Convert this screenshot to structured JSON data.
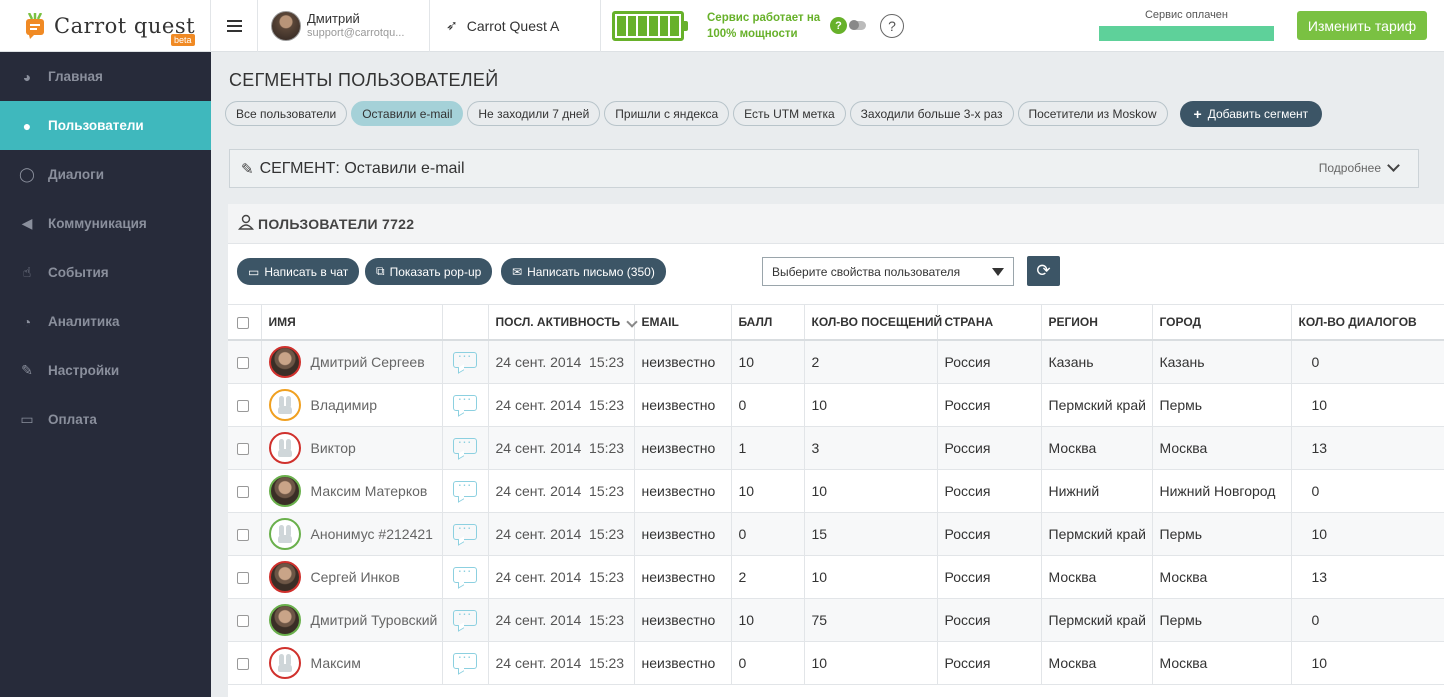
{
  "app": {
    "logo_text": "Carrot quest",
    "logo_badge": "beta"
  },
  "user": {
    "name": "Дмитрий",
    "email": "support@carrotqu..."
  },
  "project": {
    "name": "Carrot Quest A"
  },
  "service": {
    "status": "Сервис работает на 100% мощности",
    "help": "?",
    "paid_label": "Сервис оплачен",
    "paid_fraction": 1.0,
    "change_tariff": "Изменить тариф"
  },
  "sidebar": {
    "items": [
      {
        "label": "Главная",
        "icon": "dashboard-icon",
        "glyph": "◕"
      },
      {
        "label": "Пользователи",
        "icon": "user-icon",
        "glyph": "●"
      },
      {
        "label": "Диалоги",
        "icon": "chat-bubble-icon",
        "glyph": "◯"
      },
      {
        "label": "Коммуникация",
        "icon": "megaphone-icon",
        "glyph": "◀"
      },
      {
        "label": "События",
        "icon": "thumbs-up-icon",
        "glyph": "☝"
      },
      {
        "label": "Аналитика",
        "icon": "pie-chart-icon",
        "glyph": "◔"
      },
      {
        "label": "Настройки",
        "icon": "wrench-icon",
        "glyph": "✎"
      },
      {
        "label": "Оплата",
        "icon": "credit-card-icon",
        "glyph": "▭"
      }
    ],
    "active_index": 1
  },
  "main": {
    "title": "СЕГМЕНТЫ ПОЛЬЗОВАТЕЛЕЙ",
    "segments": [
      "Все пользователи",
      "Оставили e-mail",
      "Не заходили 7 дней",
      "Пришли с яндекса",
      "Есть UTM метка",
      "Заходили больше 3-х раз",
      "Посетители из Moskow"
    ],
    "active_segment": 1,
    "add_segment": "Добавить сегмент",
    "segment_title": "СЕГМЕНТ: Оставили e-mail",
    "more": "Подробнее",
    "users_title": "ПОЛЬЗОВАТЕЛИ 7722",
    "actions": {
      "chat": "Написать в чат",
      "popup": "Показать pop-up",
      "email": "Написать письмо (350)"
    },
    "props_placeholder": "Выберите свойства пользователя"
  },
  "table": {
    "columns": [
      "ИМЯ",
      "",
      "ПОСЛ. АКТИВНОСТЬ",
      "EMAIL",
      "БАЛЛ",
      "КОЛ-ВО ПОСЕЩЕНИЙ",
      "СТРАНА",
      "РЕГИОН",
      "ГОРОД",
      "КОЛ-ВО ДИАЛОГОВ"
    ],
    "rows": [
      {
        "name": "Дмитрий Сергеев",
        "avatar": "photo",
        "ring": "#d0312d",
        "date": "24 сент. 2014",
        "time": "15:23",
        "email": "неизвестно",
        "score": "10",
        "visits": "2",
        "country": "Россия",
        "region": "Казань",
        "city": "Казань",
        "dialogs": "0"
      },
      {
        "name": "Владимир",
        "avatar": "bunny",
        "ring": "#f0a020",
        "date": "24 сент. 2014",
        "time": "15:23",
        "email": "неизвестно",
        "score": "0",
        "visits": "10",
        "country": "Россия",
        "region": "Пермский край",
        "city": "Пермь",
        "dialogs": "10"
      },
      {
        "name": "Виктор",
        "avatar": "bunny",
        "ring": "#d0312d",
        "date": "24 сент. 2014",
        "time": "15:23",
        "email": "неизвестно",
        "score": "1",
        "visits": "3",
        "country": "Россия",
        "region": "Москва",
        "city": "Москва",
        "dialogs": "13"
      },
      {
        "name": "Максим Матерков",
        "avatar": "photo",
        "ring": "#6ab04c",
        "date": "24 сент. 2014",
        "time": "15:23",
        "email": "неизвестно",
        "score": "10",
        "visits": "10",
        "country": "Россия",
        "region": "Нижний",
        "city": "Нижний Новгород",
        "dialogs": "0"
      },
      {
        "name": "Анонимус #212421",
        "avatar": "bunny",
        "ring": "#6ab04c",
        "date": "24 сент. 2014",
        "time": "15:23",
        "email": "неизвестно",
        "score": "0",
        "visits": "15",
        "country": "Россия",
        "region": "Пермский край",
        "city": "Пермь",
        "dialogs": "10"
      },
      {
        "name": "Сергей Инков",
        "avatar": "photo",
        "ring": "#d0312d",
        "date": "24 сент. 2014",
        "time": "15:23",
        "email": "неизвестно",
        "score": "2",
        "visits": "10",
        "country": "Россия",
        "region": "Москва",
        "city": "Москва",
        "dialogs": "13"
      },
      {
        "name": "Дмитрий Туровский",
        "avatar": "photo",
        "ring": "#6ab04c",
        "date": "24 сент. 2014",
        "time": "15:23",
        "email": "неизвестно",
        "score": "10",
        "visits": "75",
        "country": "Россия",
        "region": "Пермский край",
        "city": "Пермь",
        "dialogs": "0"
      },
      {
        "name": "Максим",
        "avatar": "bunny",
        "ring": "#d0312d",
        "date": "24 сент. 2014",
        "time": "15:23",
        "email": "неизвестно",
        "score": "0",
        "visits": "10",
        "country": "Россия",
        "region": "Москва",
        "city": "Москва",
        "dialogs": "10"
      }
    ]
  }
}
